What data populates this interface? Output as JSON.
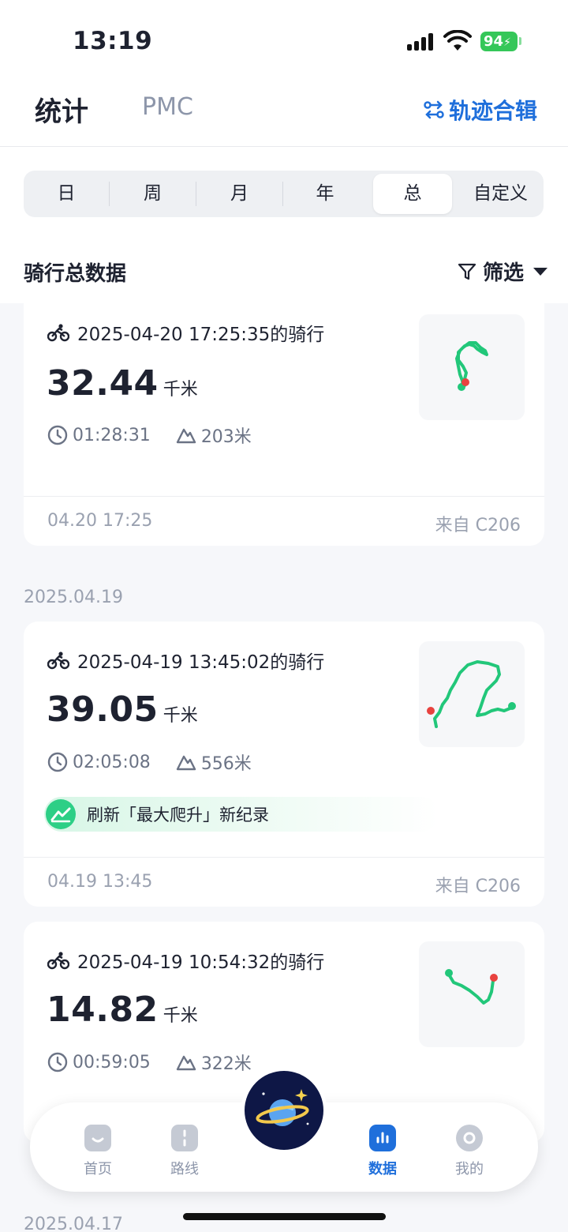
{
  "status_bar": {
    "time": "13:19",
    "battery": "94"
  },
  "header": {
    "tab_stats": "统计",
    "tab_pmc": "PMC",
    "track_collection": "轨迹合辑"
  },
  "period_tabs": [
    "日",
    "周",
    "月",
    "年",
    "总",
    "自定义"
  ],
  "active_period": "总",
  "section": {
    "title": "骑行总数据",
    "filter_label": "筛选"
  },
  "rides": [
    {
      "title": "2025-04-20 17:25:35的骑行",
      "distance": "32.44",
      "unit": "千米",
      "duration": "01:28:31",
      "elevation": "203米",
      "date_time": "04.20 17:25",
      "source": "来自 C206"
    },
    {
      "group_date": "2025.04.19",
      "title": "2025-04-19 13:45:02的骑行",
      "distance": "39.05",
      "unit": "千米",
      "duration": "02:05:08",
      "elevation": "556米",
      "badge": "刷新「最大爬升」新纪录",
      "date_time": "04.19 13:45",
      "source": "来自 C206"
    },
    {
      "title": "2025-04-19 10:54:32的骑行",
      "distance": "14.82",
      "unit": "千米",
      "duration": "00:59:05",
      "elevation": "322米"
    }
  ],
  "next_group_date": "2025.04.17",
  "bottom_nav": [
    {
      "label": "首页",
      "icon": "home-icon",
      "active": false
    },
    {
      "label": "路线",
      "icon": "route-icon",
      "active": false
    },
    {
      "label": "数据",
      "icon": "data-icon",
      "active": true
    },
    {
      "label": "我的",
      "icon": "profile-icon",
      "active": false
    }
  ],
  "colors": {
    "accent": "#1f6fdb",
    "route": "#22c77a",
    "end_marker": "#e8423f",
    "badge": "#2dcf86"
  }
}
